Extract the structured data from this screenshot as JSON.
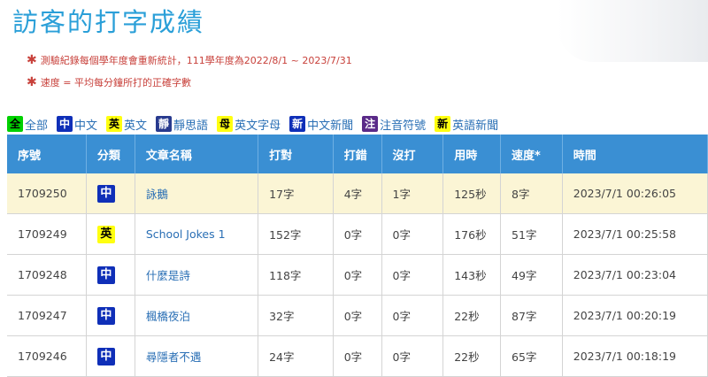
{
  "page": {
    "title": "訪客的打字成績",
    "notes": [
      "測驗紀錄每個學年度會重新統計，111學年度為2022/8/1 ~ 2023/7/31",
      "速度 = 平均每分鐘所打的正確字數"
    ]
  },
  "filters": [
    {
      "badge": "全",
      "label": "全部",
      "style": "b-green"
    },
    {
      "badge": "中",
      "label": "中文",
      "style": "b-blue"
    },
    {
      "badge": "英",
      "label": "英文",
      "style": "b-yellow"
    },
    {
      "badge": "靜",
      "label": "靜思語",
      "style": "b-navy"
    },
    {
      "badge": "母",
      "label": "英文字母",
      "style": "b-yellow"
    },
    {
      "badge": "新",
      "label": "中文新聞",
      "style": "b-blue"
    },
    {
      "badge": "注",
      "label": "注音符號",
      "style": "b-purple"
    },
    {
      "badge": "新",
      "label": "英語新聞",
      "style": "b-yellow"
    }
  ],
  "table": {
    "headers": [
      "序號",
      "分類",
      "文章名稱",
      "打對",
      "打錯",
      "沒打",
      "用時",
      "速度*",
      "時間"
    ],
    "rows": [
      {
        "id": "1709250",
        "cat": "中",
        "cat_style": "b-blue",
        "title": "詠鵝",
        "correct": "17字",
        "wrong": "4字",
        "missed": "1字",
        "time_used": "125秒",
        "speed": "8字",
        "datetime": "2023/7/1 00:26:05",
        "highlight": true
      },
      {
        "id": "1709249",
        "cat": "英",
        "cat_style": "b-yellow",
        "title": "School Jokes 1",
        "correct": "152字",
        "wrong": "0字",
        "missed": "0字",
        "time_used": "176秒",
        "speed": "51字",
        "datetime": "2023/7/1 00:25:58",
        "highlight": false
      },
      {
        "id": "1709248",
        "cat": "中",
        "cat_style": "b-blue",
        "title": "什麼是詩",
        "correct": "118字",
        "wrong": "0字",
        "missed": "0字",
        "time_used": "143秒",
        "speed": "49字",
        "datetime": "2023/7/1 00:23:04",
        "highlight": false
      },
      {
        "id": "1709247",
        "cat": "中",
        "cat_style": "b-blue",
        "title": "楓橋夜泊",
        "correct": "32字",
        "wrong": "0字",
        "missed": "0字",
        "time_used": "22秒",
        "speed": "87字",
        "datetime": "2023/7/1 00:20:19",
        "highlight": false
      },
      {
        "id": "1709246",
        "cat": "中",
        "cat_style": "b-blue",
        "title": "尋隱者不遇",
        "correct": "24字",
        "wrong": "0字",
        "missed": "0字",
        "time_used": "22秒",
        "speed": "65字",
        "datetime": "2023/7/1 00:18:19",
        "highlight": false
      }
    ]
  }
}
